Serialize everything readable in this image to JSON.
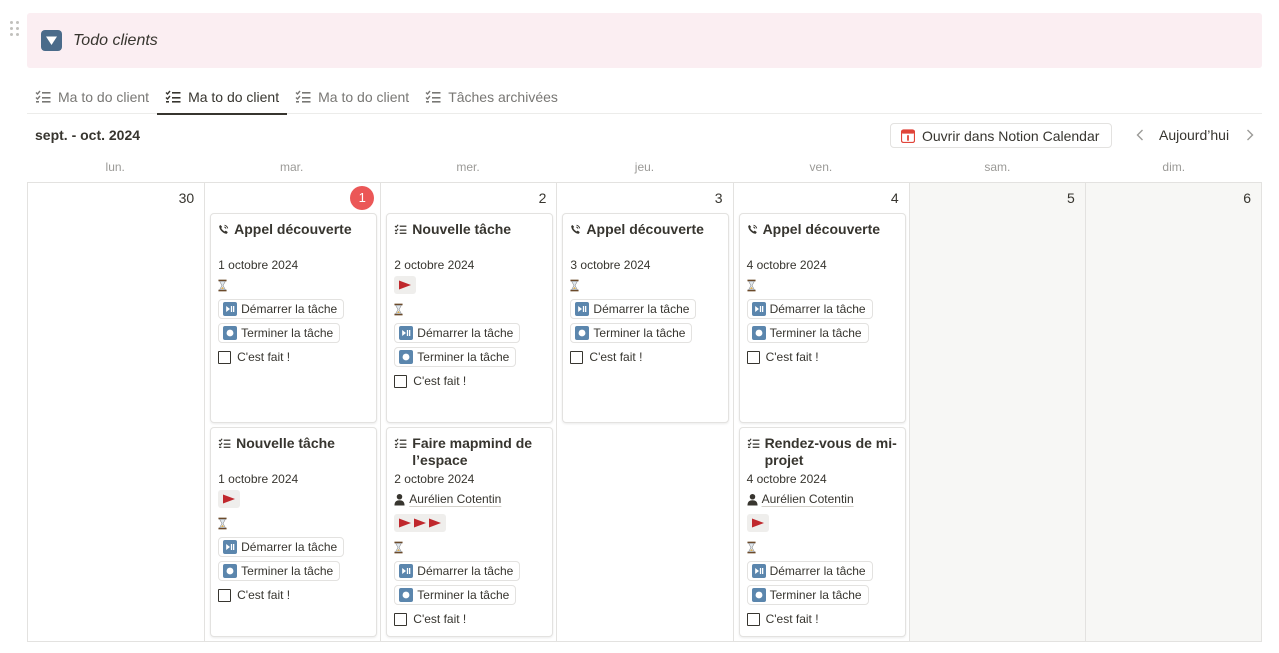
{
  "header": {
    "title": "Todo clients",
    "icon": "triangle-down-icon"
  },
  "tabs": [
    {
      "label": "Ma to do client",
      "active": false
    },
    {
      "label": "Ma to do client",
      "active": true
    },
    {
      "label": "Ma to do client",
      "active": false
    },
    {
      "label": "Tâches archivées",
      "active": false
    }
  ],
  "toolbar": {
    "range": "sept. - oct. 2024",
    "open_calendar": "Ouvrir dans Notion Calendar",
    "today": "Aujourd’hui"
  },
  "weekdays": [
    "lun.",
    "mar.",
    "mer.",
    "jeu.",
    "ven.",
    "sam.",
    "dim."
  ],
  "days": [
    {
      "num": "30",
      "today": false,
      "weekend": false
    },
    {
      "num": "1",
      "today": true,
      "weekend": false
    },
    {
      "num": "2",
      "today": false,
      "weekend": false
    },
    {
      "num": "3",
      "today": false,
      "weekend": false
    },
    {
      "num": "4",
      "today": false,
      "weekend": false
    },
    {
      "num": "5",
      "today": false,
      "weekend": true
    },
    {
      "num": "6",
      "today": false,
      "weekend": true
    }
  ],
  "labels": {
    "start_task": "Démarrer la tâche",
    "finish_task": "Terminer la tâche",
    "done": "C'est fait !"
  },
  "cards": {
    "c1a": {
      "title": "Appel découverte",
      "date": "1 octobre 2024"
    },
    "c1b": {
      "title": "Nouvelle tâche",
      "date": "1 octobre 2024"
    },
    "c2a": {
      "title": "Nouvelle tâche",
      "date": "2 octobre 2024"
    },
    "c2b": {
      "title": "Faire mapmind de l’espace",
      "date": "2 octobre 2024",
      "person": "Aurélien Cotentin"
    },
    "c3a": {
      "title": "Appel découverte",
      "date": "3 octobre 2024"
    },
    "c4a": {
      "title": "Appel découverte",
      "date": "4 octobre 2024"
    },
    "c4b": {
      "title": "Rendez-vous de mi-projet",
      "date": "4 octobre 2024",
      "person": "Aurélien Cotentin"
    }
  },
  "colors": {
    "header_bg": "#fbeef2",
    "today_badge": "#eb5757",
    "flag": "#c0282d",
    "weekend_bg": "#f7f7f5"
  }
}
